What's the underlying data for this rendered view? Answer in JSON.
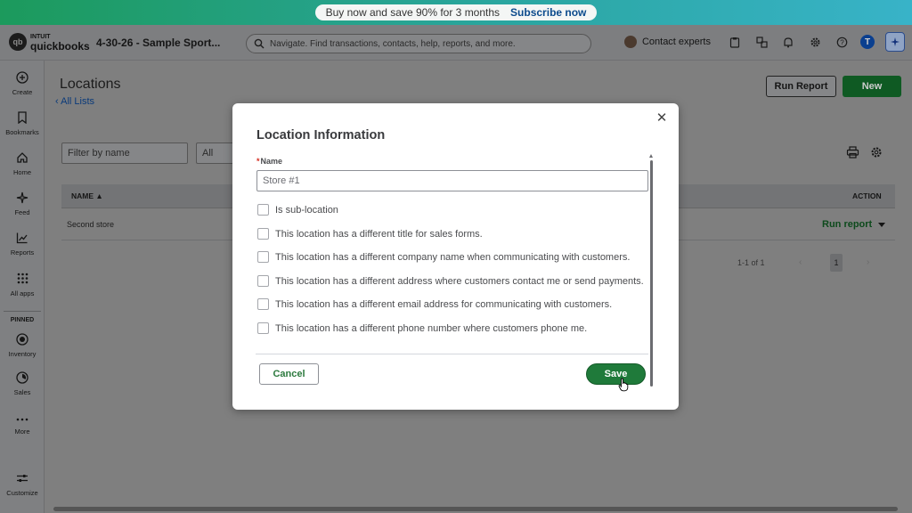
{
  "promo": {
    "text": "Buy now and save 90% for 3 months",
    "cta": "Subscribe now"
  },
  "header": {
    "logo_top": "INTUIT",
    "logo_bottom": "quickbooks",
    "logo_mark": "qb",
    "company": "4-30-26 - Sample Sport...",
    "search_placeholder": "Navigate. Find transactions, contacts, help, reports, and more.",
    "contact_label": "Contact experts",
    "user_initial": "T",
    "icons": [
      "clipboard-icon",
      "app-switch-icon",
      "bell-icon",
      "gear-icon",
      "help-icon",
      "user-avatar",
      "assistant-icon"
    ]
  },
  "sidebar": {
    "items": [
      {
        "label": "Create",
        "icon": "plus-circle-icon"
      },
      {
        "label": "Bookmarks",
        "icon": "bookmark-icon"
      },
      {
        "label": "Home",
        "icon": "home-icon"
      },
      {
        "label": "Feed",
        "icon": "sparkle-icon"
      },
      {
        "label": "Reports",
        "icon": "chart-icon"
      },
      {
        "label": "All apps",
        "icon": "grid-icon"
      }
    ],
    "pinned_label": "PINNED",
    "pinned": [
      {
        "label": "Inventory",
        "icon": "inventory-icon"
      },
      {
        "label": "Sales",
        "icon": "sales-icon"
      },
      {
        "label": "More",
        "icon": "more-icon"
      }
    ],
    "customize": {
      "label": "Customize",
      "icon": "sliders-icon"
    }
  },
  "page": {
    "title": "Locations",
    "back_link": "All Lists",
    "run_report_button": "Run Report",
    "new_button": "New",
    "filter_placeholder": "Filter by name",
    "status_select": "All",
    "columns": {
      "name": "NAME",
      "action": "ACTION"
    },
    "rows": [
      {
        "name": "Second store",
        "action": "Run report"
      }
    ],
    "pager": {
      "range": "1-1 of 1",
      "current_page": "1"
    }
  },
  "modal": {
    "title": "Location Information",
    "name_label": "Name",
    "name_required_mark": "*",
    "name_value": "Store #1",
    "checkboxes": [
      "Is sub-location",
      "This location has a different title for sales forms.",
      "This location has a different company name when communicating with customers.",
      "This location has a different address where customers contact me or send payments.",
      "This location has a different email address for communicating with customers.",
      "This location has a different phone number where customers phone me."
    ],
    "cancel_button": "Cancel",
    "save_button": "Save"
  },
  "colors": {
    "brand_green": "#1f7a3a",
    "link_blue": "#0a3a7a",
    "required_red": "#d52b1e"
  }
}
